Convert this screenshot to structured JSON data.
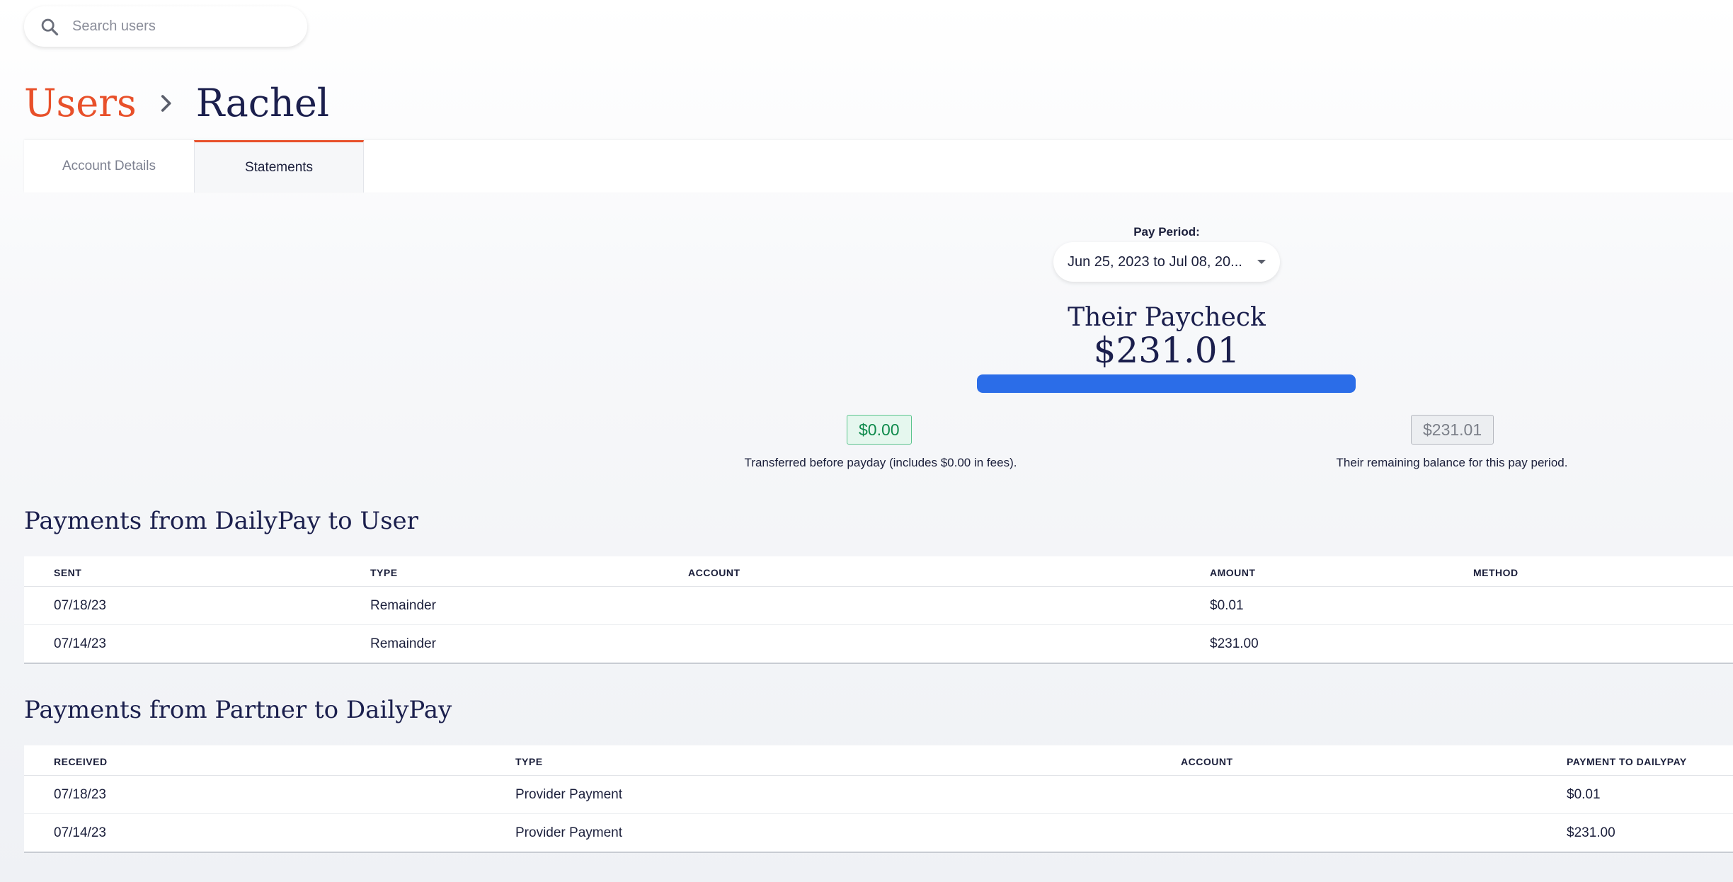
{
  "search": {
    "placeholder": "Search users",
    "icon": "search-icon"
  },
  "breadcrumb": {
    "parent": "Users",
    "current": "Rachel",
    "separator_icon": "chevron-right-icon"
  },
  "tabs": [
    {
      "label": "Account Details",
      "active": false
    },
    {
      "label": "Statements",
      "active": true
    }
  ],
  "pay_period": {
    "label": "Pay Period:",
    "selected": "Jun 25, 2023 to Jul 08, 20...",
    "dropdown_icon": "caret-down-icon"
  },
  "paycheck": {
    "title": "Their Paycheck",
    "amount": "$231.01",
    "progress_percent": 100,
    "progress_color": "#2b6de8"
  },
  "summary": {
    "transferred": {
      "amount": "$0.00",
      "caption": "Transferred before payday (includes $0.00 in fees)."
    },
    "remaining": {
      "amount": "$231.01",
      "caption": "Their remaining balance for this pay period."
    }
  },
  "dailypay_to_user": {
    "title": "Payments from DailyPay to User",
    "columns": [
      "SENT",
      "TYPE",
      "ACCOUNT",
      "AMOUNT",
      "METHOD"
    ],
    "rows": [
      {
        "sent": "07/18/23",
        "type": "Remainder",
        "account": "",
        "amount": "$0.01",
        "method": ""
      },
      {
        "sent": "07/14/23",
        "type": "Remainder",
        "account": "",
        "amount": "$231.00",
        "method": ""
      }
    ]
  },
  "partner_to_dailypay": {
    "title": "Payments from Partner to DailyPay",
    "columns": [
      "RECEIVED",
      "TYPE",
      "ACCOUNT",
      "PAYMENT TO DAILYPAY"
    ],
    "rows": [
      {
        "received": "07/18/23",
        "type": "Provider Payment",
        "account": "",
        "payment": "$0.01"
      },
      {
        "received": "07/14/23",
        "type": "Provider Payment",
        "account": "",
        "payment": "$231.00"
      }
    ]
  },
  "colors": {
    "accent": "#e8502a",
    "navy": "#1b1f4d",
    "success": "#0f8a4c",
    "progress": "#2b6de8"
  }
}
